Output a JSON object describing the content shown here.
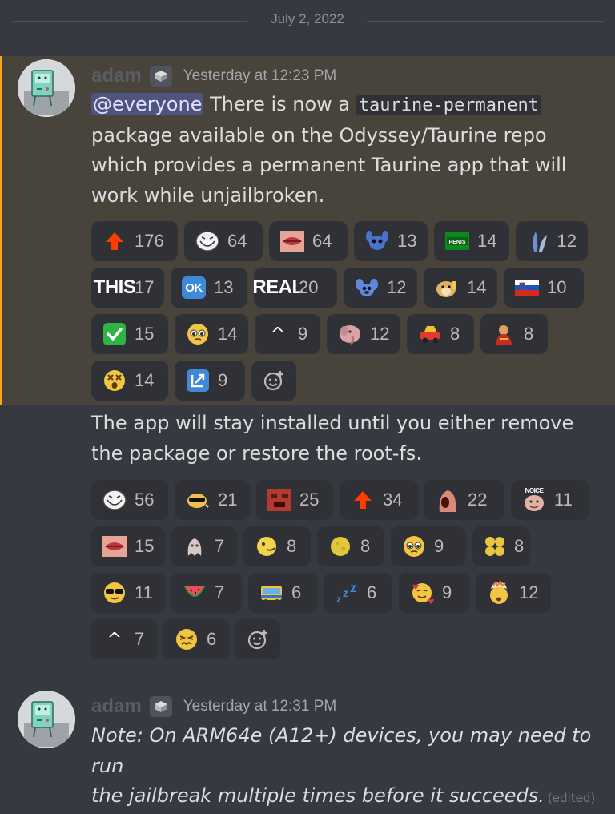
{
  "divider": {
    "date": "July 2, 2022"
  },
  "messages": [
    {
      "author": "adam",
      "timestamp": "Yesterday at 12:23 PM",
      "mention": "@everyone",
      "text_1": " There is now a ",
      "code": "taurine-permanent",
      "line_2": "package available on the Odyssey/Taurine repo",
      "line_3": "which provides a permanent Taurine app that will",
      "line_4": "work while unjailbroken.",
      "reactions": [
        {
          "emoji": "up-arrow",
          "count": "176"
        },
        {
          "emoji": "trollface",
          "count": "64"
        },
        {
          "emoji": "lips",
          "count": "64"
        },
        {
          "emoji": "stitch-blue",
          "count": "13"
        },
        {
          "emoji": "green-banner",
          "count": "14"
        },
        {
          "emoji": "rabbit-ear",
          "count": "12"
        },
        {
          "emoji": "this-text",
          "label": "THIS",
          "count": "17"
        },
        {
          "emoji": "ok-button",
          "label": "OK",
          "count": "13"
        },
        {
          "emoji": "real-text",
          "label": "REAL",
          "count": "20"
        },
        {
          "emoji": "stitch",
          "count": "12"
        },
        {
          "emoji": "doge-thumbs",
          "count": "14"
        },
        {
          "emoji": "slovenia-flag",
          "count": "10"
        },
        {
          "emoji": "check-mark",
          "count": "15"
        },
        {
          "emoji": "pleading-face",
          "count": "14"
        },
        {
          "emoji": "caret-up",
          "label": "^",
          "count": "9"
        },
        {
          "emoji": "elephant-pink",
          "count": "12"
        },
        {
          "emoji": "toy-car",
          "count": "8"
        },
        {
          "emoji": "red-character",
          "count": "8"
        },
        {
          "emoji": "dizzy-face",
          "count": "14"
        },
        {
          "emoji": "input-symbol",
          "count": "9"
        }
      ]
    },
    {
      "line_1": "The app will stay installed until you either remove",
      "line_2": "the package or restore the root-fs.",
      "reactions": [
        {
          "emoji": "trollface",
          "count": "56"
        },
        {
          "emoji": "cool-cat",
          "count": "21"
        },
        {
          "emoji": "angry-face-red",
          "count": "25"
        },
        {
          "emoji": "up-arrow",
          "count": "34"
        },
        {
          "emoji": "screaming-mouth",
          "count": "22"
        },
        {
          "emoji": "noice",
          "label": "NOICE",
          "count": "11"
        },
        {
          "emoji": "lips",
          "count": "15"
        },
        {
          "emoji": "ghost-fish",
          "count": "7"
        },
        {
          "emoji": "yellow-pacman",
          "count": "8"
        },
        {
          "emoji": "yellow-ball",
          "count": "8"
        },
        {
          "emoji": "pleading-face",
          "count": "9"
        },
        {
          "emoji": "yellow-blob",
          "count": "8"
        },
        {
          "emoji": "sunglasses-face",
          "count": "11"
        },
        {
          "emoji": "watermelon",
          "count": "7"
        },
        {
          "emoji": "tram",
          "count": "6"
        },
        {
          "emoji": "zzz",
          "count": "6"
        },
        {
          "emoji": "smiling-hearts",
          "count": "9"
        },
        {
          "emoji": "exploding-head",
          "count": "12"
        },
        {
          "emoji": "caret-up",
          "label": "^",
          "count": "7"
        },
        {
          "emoji": "persevering-face",
          "count": "6"
        }
      ]
    },
    {
      "author": "adam",
      "timestamp": "Yesterday at 12:31 PM",
      "line_1": "Note: On ARM64e (A12+) devices, you may need to run",
      "line_2": "the jailbreak multiple times before it succeeds.",
      "edited": "(edited)"
    }
  ],
  "colors": {
    "background": "#36393f",
    "mention_highlight": "#48443c",
    "highlight_border": "#faa81a",
    "reaction_bg": "#2f3136",
    "mention_bg": "#4e547f"
  }
}
